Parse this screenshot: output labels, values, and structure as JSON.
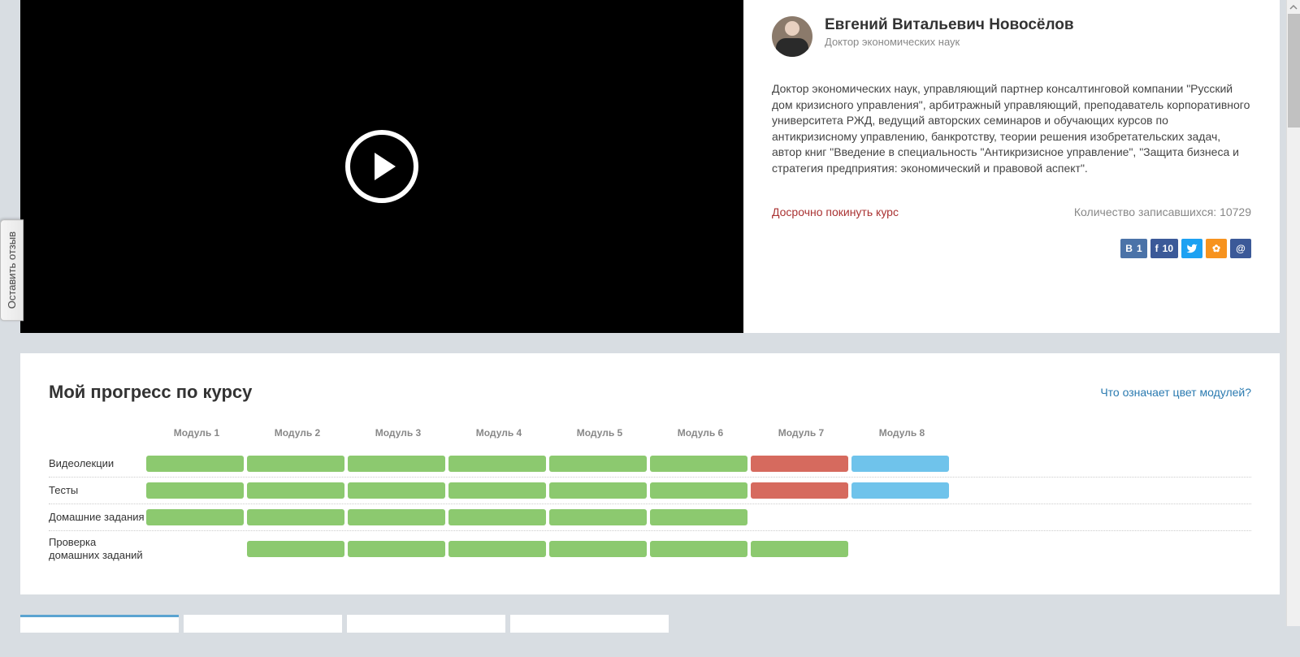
{
  "instructor": {
    "name": "Евгений Витальевич Новосёлов",
    "title": "Доктор экономических наук",
    "bio": "Доктор экономических наук, управляющий партнер консалтинговой компании \"Русский дом кризисного управления\", арбитражный управляющий, преподаватель корпоративного университета РЖД, ведущий авторских семинаров и обучающих курсов по антикризисному управлению, банкротству, теории решения изобретательских задач, автор книг \"Введение в специальность \"Антикризисное управление\", \"Защита бизнеса и стратегия предприятия: экономический и правовой аспект\"."
  },
  "course": {
    "leave_label": "Досрочно покинуть курс",
    "enroll_label": "Количество записавшихся: 10729"
  },
  "social": {
    "vk_letter": "В",
    "vk_count": "1",
    "fb_letter": "f",
    "fb_count": "10",
    "ok_glyph": "✿",
    "mail_glyph": "@"
  },
  "progress": {
    "title": "Мой прогресс по курсу",
    "help_link": "Что означает цвет модулей?",
    "modules": [
      "Модуль 1",
      "Модуль 2",
      "Модуль 3",
      "Модуль 4",
      "Модуль 5",
      "Модуль 6",
      "Модуль 7",
      "Модуль 8"
    ],
    "rows": [
      {
        "label": "Видеолекции",
        "cells": [
          "green",
          "green",
          "green",
          "green",
          "green",
          "green",
          "red",
          "blue"
        ]
      },
      {
        "label": "Тесты",
        "cells": [
          "green",
          "green",
          "green",
          "green",
          "green",
          "green",
          "red",
          "blue"
        ]
      },
      {
        "label": "Домашние задания",
        "cells": [
          "green",
          "green",
          "green",
          "green",
          "green",
          "green",
          "empty",
          "empty"
        ]
      },
      {
        "label": "Проверка домашних заданий",
        "cells": [
          "empty",
          "green",
          "green",
          "green",
          "green",
          "green",
          "green",
          "empty"
        ]
      }
    ]
  },
  "feedback": {
    "label": "Оставить отзыв"
  }
}
